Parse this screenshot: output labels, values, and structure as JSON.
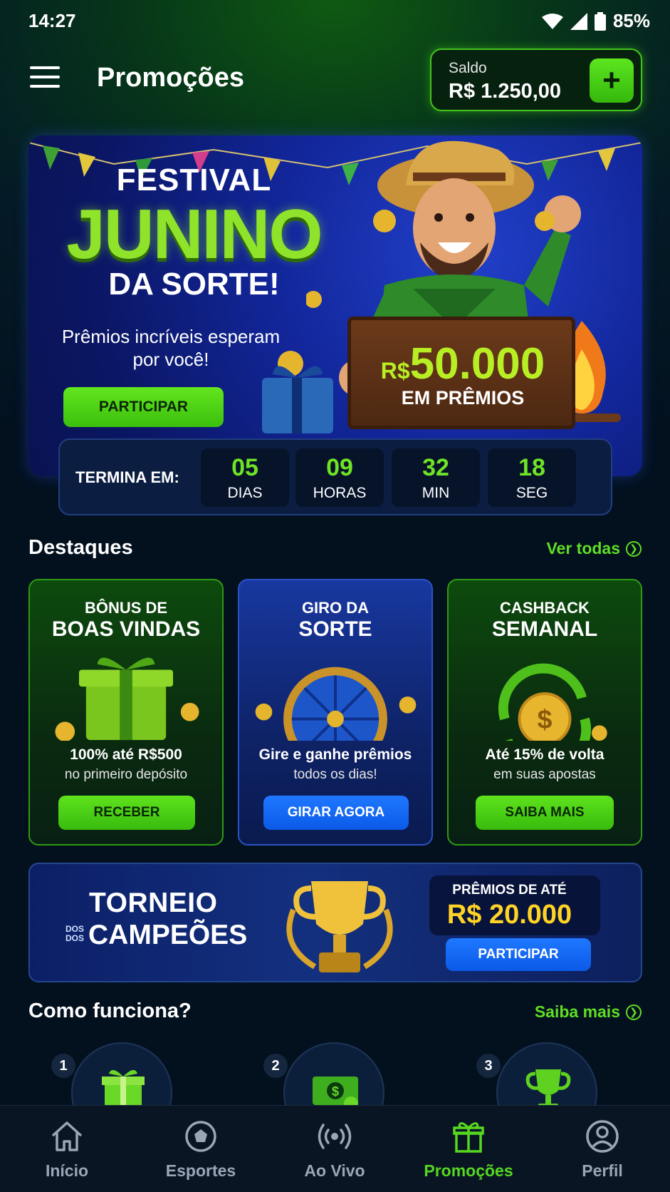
{
  "status_bar": {
    "time": "14:27",
    "battery": "85%"
  },
  "header": {
    "title": "Promoções",
    "balance_label": "Saldo",
    "balance_value": "R$ 1.250,00",
    "add_symbol": "+"
  },
  "hero": {
    "title_line1": "FESTIVAL",
    "title_line2": "JUNINO",
    "title_line3": "DA SORTE!",
    "subtitle": "Prêmios incríveis esperam por você!",
    "button_label": "PARTICIPAR",
    "prize_currency": "R$",
    "prize_amount": "50.000",
    "prize_caption": "EM PRÊMIOS"
  },
  "countdown": {
    "label": "TERMINA EM:",
    "units": [
      {
        "value": "05",
        "unit": "DIAS"
      },
      {
        "value": "09",
        "unit": "HORAS"
      },
      {
        "value": "32",
        "unit": "MIN"
      },
      {
        "value": "18",
        "unit": "SEG"
      }
    ]
  },
  "highlights": {
    "title": "Destaques",
    "link": "Ver todas",
    "cards": [
      {
        "title_line1": "BÔNUS DE",
        "title_line2": "BOAS VINDAS",
        "line1": "100% até R$500",
        "line2": "no primeiro depósito",
        "button": "RECEBER"
      },
      {
        "title_line1": "GIRO DA",
        "title_line2": "SORTE",
        "line1": "Gire e ganhe prêmios",
        "line2": "todos os dias!",
        "button": "GIRAR AGORA"
      },
      {
        "title_line1": "CASHBACK",
        "title_line2": "SEMANAL",
        "line1": "Até 15% de volta",
        "line2": "em suas apostas",
        "button": "SAIBA MAIS"
      }
    ]
  },
  "tournament": {
    "title_line1": "TORNEIO",
    "small_text": "DOS",
    "small_text2": "DOS",
    "title_line2": "CAMPEÕES",
    "prize_label": "PRÊMIOS DE ATÉ",
    "prize_value": "R$ 20.000",
    "button": "PARTICIPAR"
  },
  "how_it_works": {
    "title": "Como funciona?",
    "link": "Saiba mais",
    "steps": [
      {
        "number": "1",
        "icon": "gift-icon"
      },
      {
        "number": "2",
        "icon": "money-icon"
      },
      {
        "number": "3",
        "icon": "trophy-icon"
      }
    ]
  },
  "bottom_nav": [
    {
      "label": "Início",
      "icon": "home-icon"
    },
    {
      "label": "Esportes",
      "icon": "ball-icon"
    },
    {
      "label": "Ao Vivo",
      "icon": "live-icon"
    },
    {
      "label": "Promoções",
      "icon": "gift-icon",
      "active": true
    },
    {
      "label": "Perfil",
      "icon": "profile-icon"
    }
  ],
  "colors": {
    "accent_green": "#5fde23",
    "accent_blue": "#0b5ae8",
    "gold": "#ffd326"
  }
}
